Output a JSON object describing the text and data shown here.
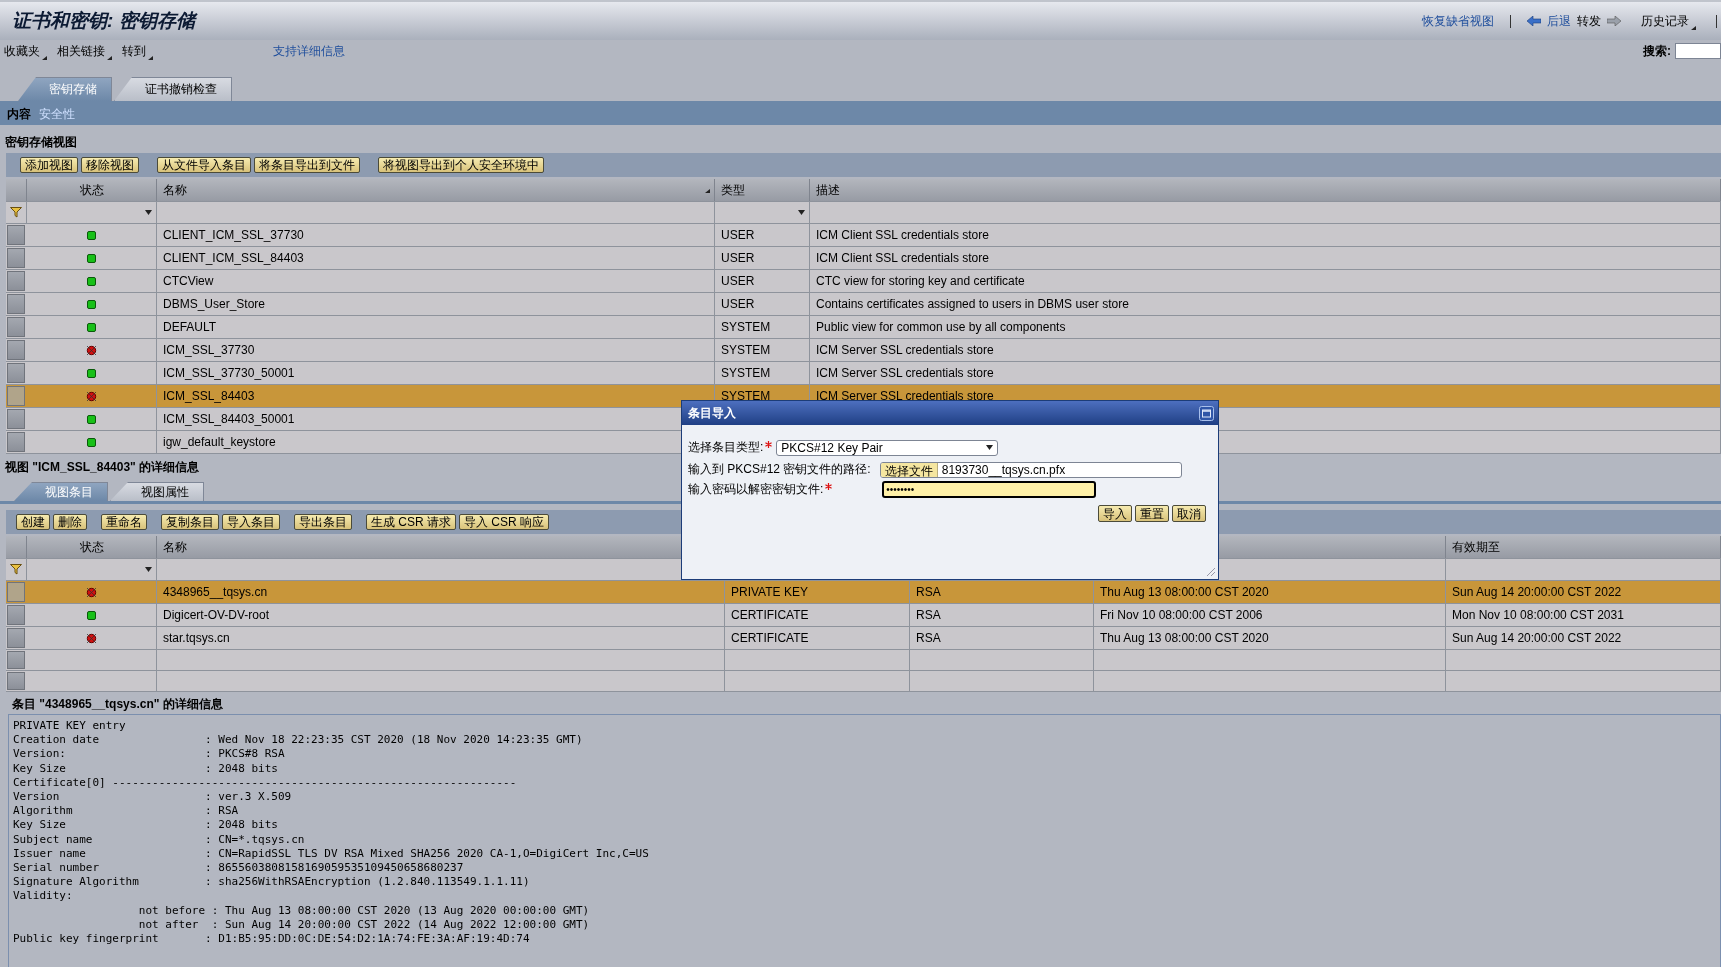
{
  "header": {
    "title": "证书和密钥: 密钥存储",
    "restore_link": "恢复缺省视图",
    "back": "后退",
    "forward": "转发",
    "history": "历史记录"
  },
  "menus": [
    "收藏夹",
    "相关链接",
    "转到"
  ],
  "support_link": "支持详细信息",
  "search": {
    "label": "搜索:"
  },
  "tabs": [
    {
      "label": "密钥存储",
      "selected": true
    },
    {
      "label": "证书撤销检查",
      "selected": false
    }
  ],
  "subnav": [
    {
      "label": "内容",
      "selected": true
    },
    {
      "label": "安全性",
      "selected": false
    }
  ],
  "store_view": {
    "title": "密钥存储视图",
    "button_groups": [
      [
        "添加视图",
        "移除视图"
      ],
      [
        "从文件导入条目",
        "将条目导出到文件"
      ],
      [
        "将视图导出到个人安全环境中"
      ]
    ],
    "columns": {
      "status": "状态",
      "name": "名称",
      "type": "类型",
      "description": "描述"
    },
    "rows": [
      {
        "kind": "ok",
        "name": "CLIENT_ICM_SSL_37730",
        "type": "USER",
        "description": "ICM Client SSL credentials store",
        "selected": false
      },
      {
        "kind": "ok",
        "name": "CLIENT_ICM_SSL_84403",
        "type": "USER",
        "description": "ICM Client SSL credentials store",
        "selected": false
      },
      {
        "kind": "ok",
        "name": "CTCView",
        "type": "USER",
        "description": "CTC view for storing key and certificate",
        "selected": false
      },
      {
        "kind": "ok",
        "name": "DBMS_User_Store",
        "type": "USER",
        "description": "Contains certificates assigned to users in DBMS user store",
        "selected": false
      },
      {
        "kind": "ok",
        "name": "DEFAULT",
        "type": "SYSTEM",
        "description": "Public view for common use by all components",
        "selected": false
      },
      {
        "kind": "error",
        "name": "ICM_SSL_37730",
        "type": "SYSTEM",
        "description": "ICM Server SSL credentials store",
        "selected": false
      },
      {
        "kind": "ok",
        "name": "ICM_SSL_37730_50001",
        "type": "SYSTEM",
        "description": "ICM Server SSL credentials store",
        "selected": false
      },
      {
        "kind": "error",
        "name": "ICM_SSL_84403",
        "type": "SYSTEM",
        "description": "ICM Server SSL credentials store",
        "selected": true
      },
      {
        "kind": "ok",
        "name": "ICM_SSL_84403_50001",
        "selected": false
      },
      {
        "kind": "ok",
        "name": "igw_default_keystore",
        "selected": false
      }
    ]
  },
  "view_detail": {
    "title": "视图 \"ICM_SSL_84403\" 的详细信息",
    "tabs": [
      {
        "label": "视图条目",
        "selected": true
      },
      {
        "label": "视图属性",
        "selected": false
      }
    ],
    "button_groups": [
      [
        "创建",
        "删除"
      ],
      [
        "重命名"
      ],
      [
        "复制条目",
        "导入条目"
      ],
      [
        "导出条目"
      ],
      [
        "生成 CSR 请求",
        "导入 CSR 响应"
      ]
    ],
    "columns": {
      "status": "状态",
      "name": "名称",
      "valid_to": "有效期至"
    },
    "rows": [
      {
        "kind": "error",
        "name": "4348965__tqsys.cn",
        "column_3": "PRIVATE KEY",
        "column_4": "RSA",
        "column_5": "Thu Aug 13 08:00:00 CST 2020",
        "valid_to": "Sun Aug 14 20:00:00 CST 2022",
        "selected": true
      },
      {
        "kind": "ok",
        "name": "Digicert-OV-DV-root",
        "column_3": "CERTIFICATE",
        "column_4": "RSA",
        "column_5": "Fri Nov 10 08:00:00 CST 2006",
        "valid_to": "Mon Nov 10 08:00:00 CST 2031",
        "selected": false
      },
      {
        "kind": "error",
        "name": "star.tqsys.cn",
        "column_3": "CERTIFICATE",
        "column_4": "RSA",
        "column_5": "Thu Aug 13 08:00:00 CST 2020",
        "valid_to": "Sun Aug 14 20:00:00 CST 2022",
        "selected": false
      }
    ]
  },
  "entry_detail": {
    "title": "条目 \"4348965__tqsys.cn\" 的详细信息",
    "lines": [
      "PRIVATE KEY entry",
      "Creation date                : Wed Nov 18 22:23:35 CST 2020 (18 Nov 2020 14:23:35 GMT)",
      "Version:                     : PKCS#8 RSA",
      "Key Size                     : 2048 bits",
      "Certificate[0] -------------------------------------------------------------",
      "Version                      : ver.3 X.509",
      "Algorithm                    : RSA",
      "Key Size                     : 2048 bits",
      "Subject name                 : CN=*.tqsys.cn",
      "Issuer name                  : CN=RapidSSL TLS DV RSA Mixed SHA256 2020 CA-1,O=DigiCert Inc,C=US",
      "Serial number                : 8655603808158169059535109450658680237",
      "Signature Algorithm          : sha256WithRSAEncryption (1.2.840.113549.1.1.11)",
      "Validity:",
      "                   not before : Thu Aug 13 08:00:00 CST 2020 (13 Aug 2020 00:00:00 GMT)",
      "                   not after  : Sun Aug 14 20:00:00 CST 2022 (14 Aug 2022 12:00:00 GMT)",
      "Public key fingerprint       : D1:B5:95:DD:0C:DE:54:D2:1A:74:FE:3A:AF:19:4D:74"
    ]
  },
  "dialog": {
    "title": "条目导入",
    "fields": [
      {
        "kind": "select",
        "label": "选择条目类型:",
        "required": true,
        "focused": false,
        "value": "PKCS#12 Key Pair"
      },
      {
        "kind": "file",
        "label": "输入到 PKCS#12 密钥文件的路径:",
        "required": false,
        "focused": false,
        "button": "选择文件",
        "value": "8193730__tqsys.cn.pfx"
      },
      {
        "kind": "password",
        "label": "输入密码以解密密钥文件:",
        "required": true,
        "focused": true,
        "value": "••••••••"
      }
    ],
    "buttons": [
      "导入",
      "重置",
      "取消"
    ]
  }
}
